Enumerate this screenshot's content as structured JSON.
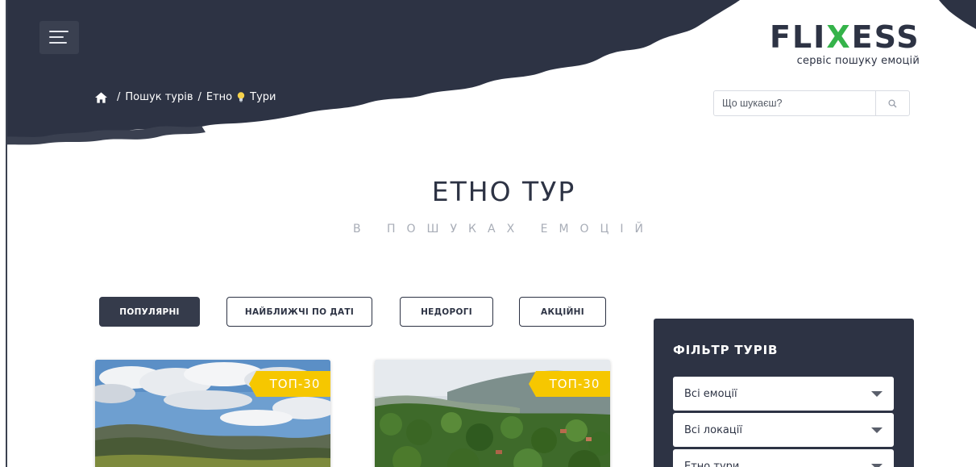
{
  "logo": {
    "word_pre": "FLI",
    "word_x": "X",
    "word_post": "ESS",
    "tagline": "сервіс пошуку емоцій"
  },
  "breadcrumb": {
    "path": "Пошук турів",
    "sep1": "/",
    "sep2": "/",
    "section_a": "Етно",
    "section_b": "Тури"
  },
  "search": {
    "placeholder": "Що шукаєш?"
  },
  "page": {
    "title": "ЕТНО ТУР",
    "subtitle": "В ПОШУКАХ ЕМОЦІЙ"
  },
  "tabs": [
    {
      "label": "ПОПУЛЯРНІ",
      "active": true
    },
    {
      "label": "НАЙБЛИЖЧІ ПО ДАТІ",
      "active": false
    },
    {
      "label": "НЕДОРОГІ",
      "active": false
    },
    {
      "label": "АКЦІЙНІ",
      "active": false
    }
  ],
  "cards": [
    {
      "badge": "ТОП-30"
    },
    {
      "badge": "ТОП-30"
    }
  ],
  "filter": {
    "title": "ФІЛЬТР ТУРІВ",
    "selects": [
      {
        "value": "Всі емоції"
      },
      {
        "value": "Всі локації"
      },
      {
        "value": "Етно тури"
      }
    ]
  },
  "colors": {
    "dark": "#2d3344",
    "accent_green": "#35b34a",
    "badge_yellow": "#f6c700",
    "muted": "#a8adb7"
  },
  "icons": [
    "menu-icon",
    "home-icon",
    "lightbulb-icon",
    "search-icon",
    "chevron-down-icon"
  ]
}
